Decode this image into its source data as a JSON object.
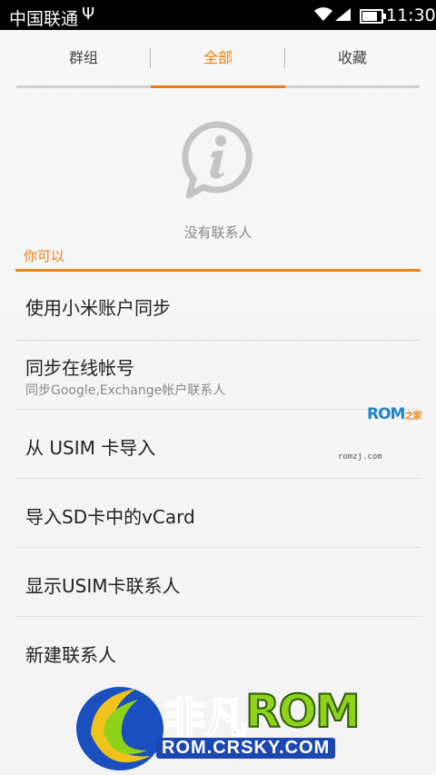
{
  "status_bar": {
    "carrier": "中国联通",
    "usb_icon": "usb-icon",
    "wifi_icon": "wifi-icon",
    "signal_icon": "signal-icon",
    "battery_icon": "battery-icon",
    "battery_level": 0.9,
    "time": "11:30"
  },
  "tabs": [
    {
      "label": "群组"
    },
    {
      "label": "全部"
    },
    {
      "label": "收藏"
    }
  ],
  "active_tab_index": 1,
  "accent_color": "#f07b0e",
  "empty_state": {
    "icon": "info-bubble-icon",
    "message": "没有联系人"
  },
  "section": {
    "header": "你可以"
  },
  "actions": [
    {
      "title": "使用小米账户同步",
      "subtitle": ""
    },
    {
      "title": "同步在线帐号",
      "subtitle": "同步Google,Exchange帐户联系人"
    },
    {
      "title": "从 USIM 卡导入",
      "subtitle": ""
    },
    {
      "title": "导入SD卡中的vCard",
      "subtitle": ""
    },
    {
      "title": "显示USIM卡联系人",
      "subtitle": ""
    },
    {
      "title": "新建联系人",
      "subtitle": ""
    }
  ],
  "watermarks": {
    "rom_text": "ROM",
    "rom_suffix": "之家",
    "romj_url": "romzj.com",
    "brand_cn": "非凡",
    "brand_rom": "ROM",
    "brand_url": "ROM.CRSKY.COM"
  }
}
